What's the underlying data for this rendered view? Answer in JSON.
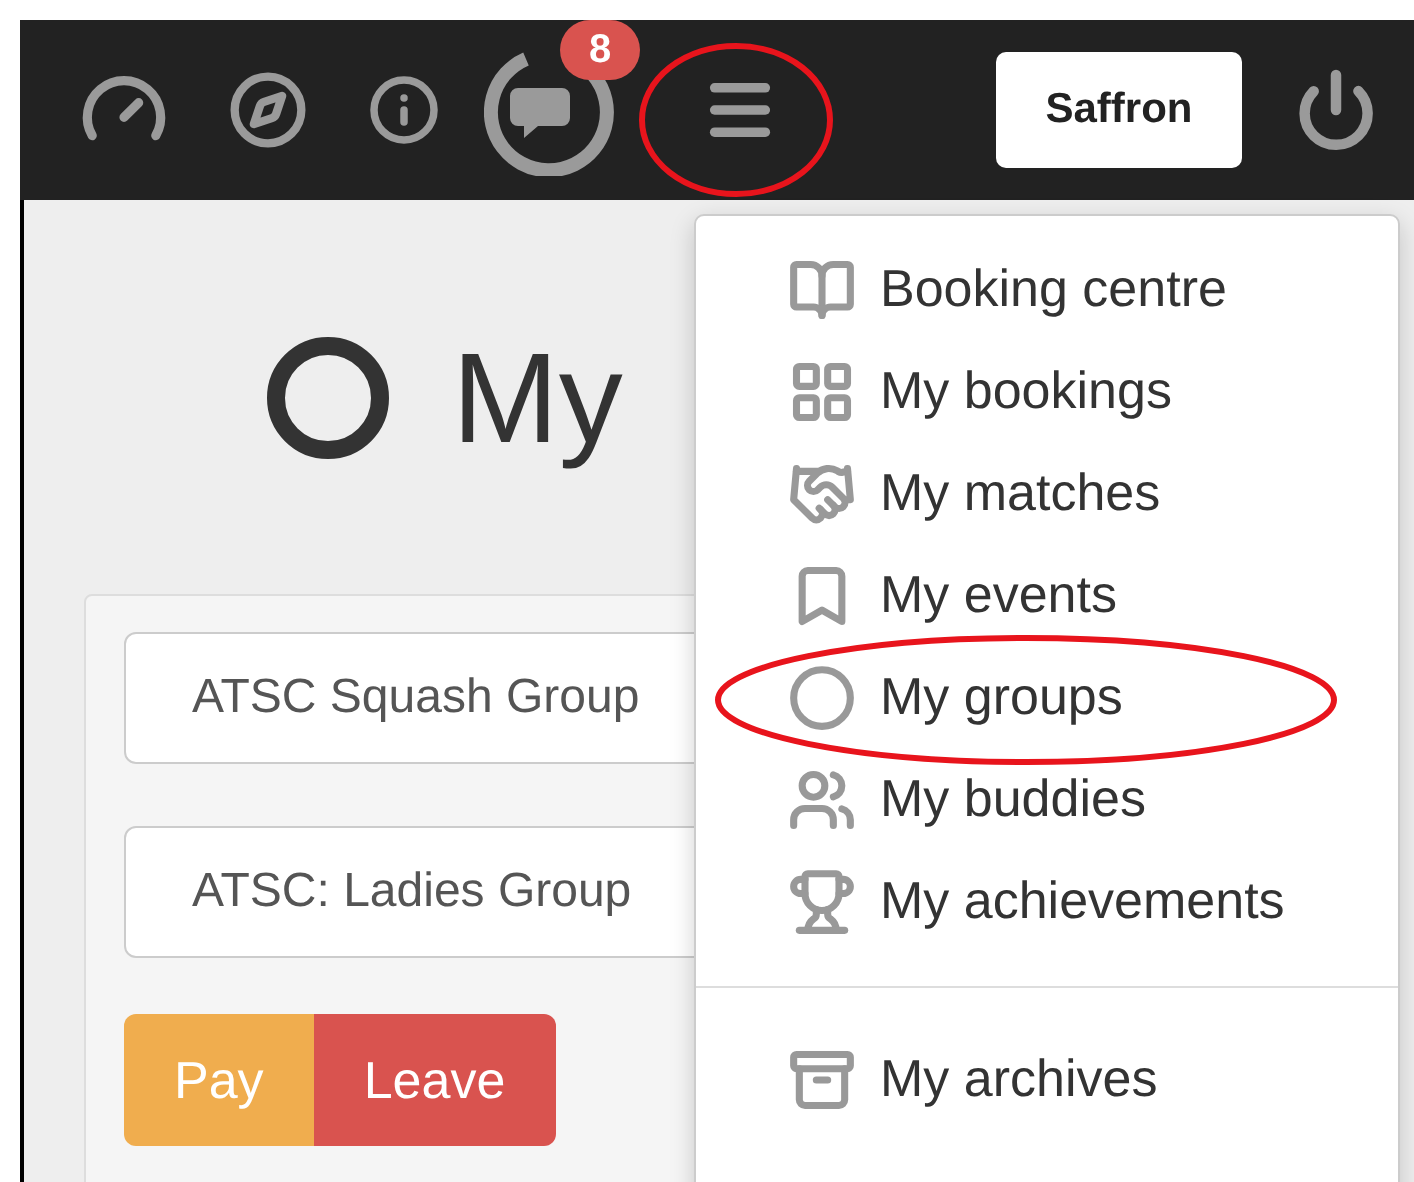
{
  "navbar": {
    "badge": "8",
    "menu_highlighted": true,
    "user_button": "Saffron"
  },
  "page": {
    "title": "My"
  },
  "groups": [
    {
      "name": "ATSC Squash Group"
    },
    {
      "name": "ATSC: Ladies Group"
    }
  ],
  "actions": [
    {
      "label": "Pay",
      "kind": "warning"
    },
    {
      "label": "Leave",
      "kind": "danger"
    }
  ],
  "menu": {
    "sections": [
      {
        "items": [
          {
            "label": "Booking centre",
            "highlighted": false
          },
          {
            "label": "My bookings",
            "highlighted": false
          },
          {
            "label": "My matches",
            "highlighted": false
          },
          {
            "label": "My events",
            "highlighted": false
          },
          {
            "label": "My groups",
            "highlighted": true
          },
          {
            "label": "My buddies",
            "highlighted": false
          },
          {
            "label": "My achievements",
            "highlighted": false
          }
        ]
      },
      {
        "items": [
          {
            "label": "My archives",
            "highlighted": false
          }
        ]
      }
    ]
  }
}
